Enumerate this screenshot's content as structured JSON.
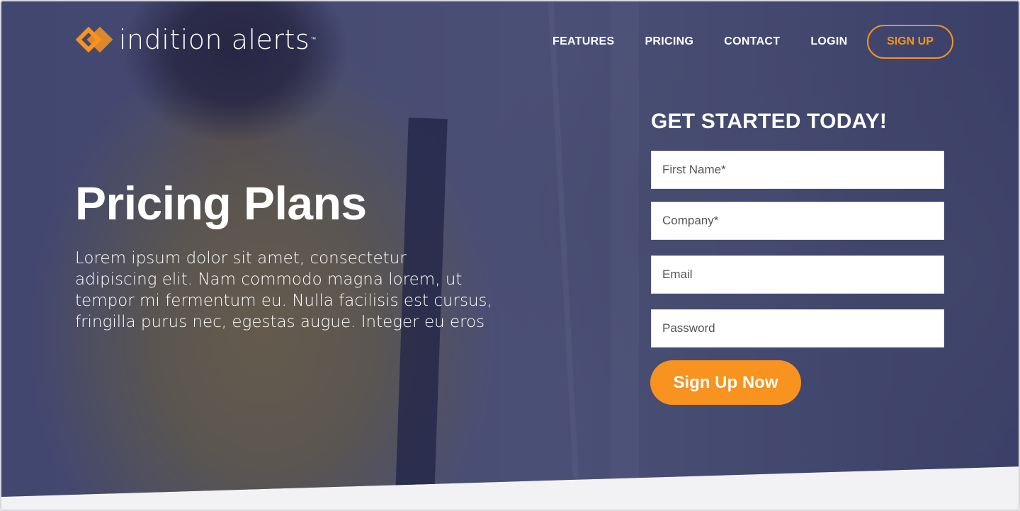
{
  "brand": {
    "name": "indition alerts",
    "trademark": "™",
    "accent_color": "#f7931e",
    "logo_icon": "diamond-logo-icon"
  },
  "nav": {
    "links": [
      "FEATURES",
      "PRICING",
      "CONTACT",
      "LOGIN"
    ],
    "signup_label": "SIGN UP"
  },
  "hero": {
    "title": "Pricing Plans",
    "text": "Lorem ipsum dolor sit amet, consectetur adipiscing elit. Nam commodo magna lorem, ut tempor mi fermentum eu. Nulla facilisis est cursus, fringilla purus nec, egestas augue. Integer eu eros",
    "overlay_color": "#262c58"
  },
  "form": {
    "title": "GET STARTED TODAY!",
    "fields": [
      {
        "placeholder": "First Name*"
      },
      {
        "placeholder": "Company*"
      },
      {
        "placeholder": "Email"
      },
      {
        "placeholder": "Password"
      }
    ],
    "submit_label": "Sign Up Now"
  }
}
